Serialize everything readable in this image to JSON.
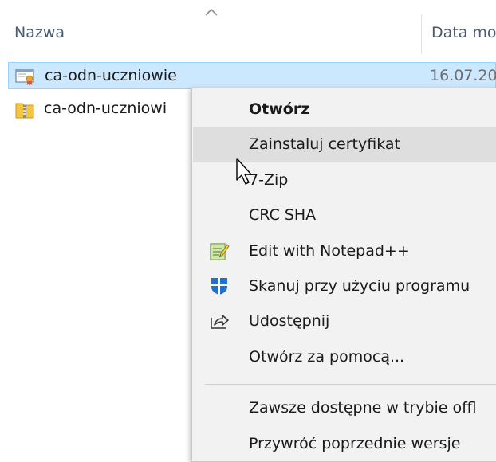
{
  "header": {
    "name_col": "Nazwa",
    "date_col": "Data mo"
  },
  "files": [
    {
      "name": "ca-odn-uczniowie",
      "date": "16.07.20",
      "icon": "certificate-icon",
      "selected": true
    },
    {
      "name": "ca-odn-uczniowi",
      "date": "",
      "icon": "zip-folder-icon",
      "selected": false
    }
  ],
  "context_menu": {
    "items": [
      {
        "label": "Otwórz",
        "bold": true,
        "icon": ""
      },
      {
        "label": "Zainstaluj certyfikat",
        "hover": true,
        "icon": ""
      },
      {
        "label": "7-Zip",
        "icon": ""
      },
      {
        "label": "CRC SHA",
        "icon": ""
      },
      {
        "label": "Edit with Notepad++",
        "icon": "notepad-plus-plus-icon"
      },
      {
        "label": "Skanuj przy użyciu programu",
        "icon": "windows-defender-shield-icon"
      },
      {
        "label": "Udostępnij",
        "icon": "share-icon"
      },
      {
        "label": "Otwórz za pomocą...",
        "icon": ""
      },
      {
        "label": "Zawsze dostępne w trybie offl",
        "icon": ""
      },
      {
        "label": "Przywróć poprzednie wersje",
        "icon": ""
      }
    ]
  },
  "colors": {
    "selection_bg": "#cce8ff",
    "selection_border": "#99d1ff",
    "menu_bg": "#f2f2f2",
    "menu_hover": "#dedede",
    "header_text": "#4a5a70"
  }
}
